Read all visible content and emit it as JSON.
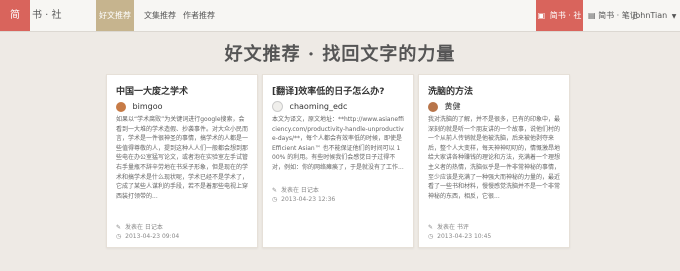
{
  "navbar": {
    "logo": "简",
    "brand": "书 · 社",
    "items": [
      {
        "label": "好文推荐",
        "active": true
      },
      {
        "label": "文集推荐",
        "active": false
      },
      {
        "label": "作者推荐",
        "active": false
      }
    ],
    "jianshu_label": "简书 · 社",
    "notes_label": "简书 · 笔记",
    "user_name": "JohnTian"
  },
  "headline": "好文推荐 · 找回文字的力量",
  "cards": [
    {
      "title": "中国一大废之学术",
      "author": "bimgoo",
      "avatar_color": "#c77b46",
      "excerpt": "如果以“学术腐败”为关键词进行google搜索，会看到一大堆的学术造假、抄袭事件。对大众小民而言，学术是一件很神圣的事情，搞学术的人都是一些值得尊敬的人，提到这种人人们一般都会想到那些电在办公室猛写论文，或者泡在实验室左手试管右手量瓶不辞辛劳地在书采子形象，但是现在的学术和搞学术是什么现状呢，学术已经不是学术了，它成了某些人谋利的手段，若不是着那些电视上穿西装打领带的...",
      "category": "发表在 日记本",
      "date": "2013-04-23 09:04"
    },
    {
      "title": "[翻译]效率低的日子怎么办?",
      "author": "chaoming_edc",
      "avatar_color": "#f0efec",
      "excerpt": "本文为译文，原文地址：**http://www.asianefficiency.com/productivity-handle-unproductive-days/**，每个人都会有效率低的时候，即使是 Efficient Asian™ 也不能保证他们的时间可以 100% 的利用。有些时候我们会感觉日子过得不对，例如：你的网络瘫痪了，于是就没有了工作...",
      "category": "发表在 日记本",
      "date": "2013-04-23 12:36"
    },
    {
      "title": "洗脑的方法",
      "author": "黄健",
      "avatar_color": "#b8754a",
      "excerpt": "我对洗脑的了解，并不是很多，已有的印象中，最深刻的就是听一个朋友讲的一个故事，说他们村的一个从前人传销就是他被洗脑，后来被他剥夺来后，整个人大变样，每天神神叨叨的，情慨激昂地给大家讲各种赚钱的理论和方法，充满着一个理想主义者的热情，洗脑似乎是一件非常神秘的事情，至少应该是充满了一种强大而神秘的力量的，最近看了一些书和材料，慢慢感觉洗脑并不是一个非常神秘的东西，相反，它很...",
      "category": "发表在 书评",
      "date": "2013-04-23 10:45"
    }
  ]
}
